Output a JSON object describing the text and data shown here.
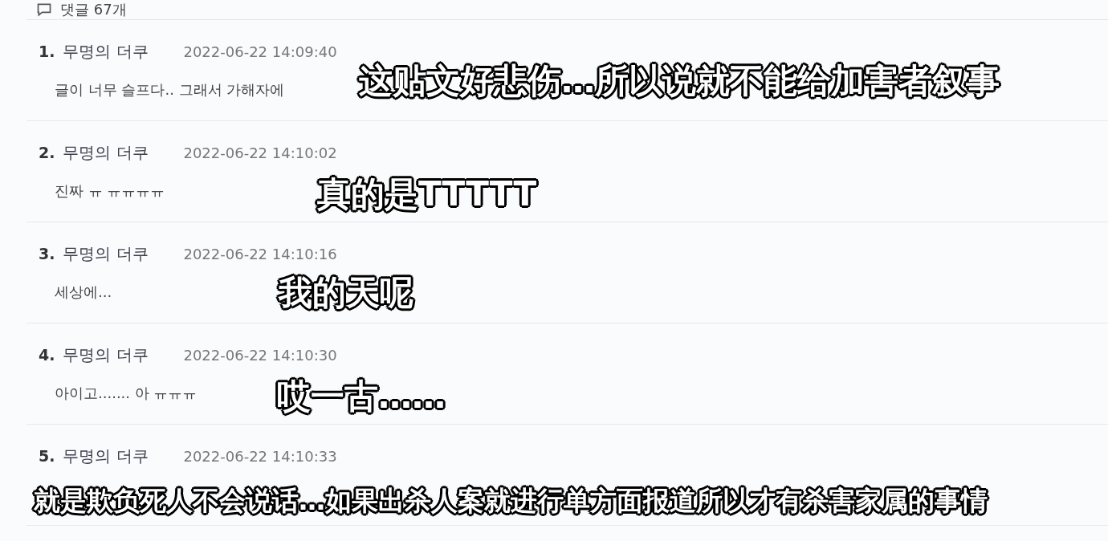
{
  "comments_header": {
    "label": "댓글 67개"
  },
  "comments": [
    {
      "number": "1.",
      "author": "무명의 더쿠",
      "time": "2022-06-22 14:09:40",
      "text": "글이 너무 슬프다.. 그래서 가해자에",
      "caption": "这贴文好悲伤…所以说就不能给加害者叙事"
    },
    {
      "number": "2.",
      "author": "무명의 더쿠",
      "time": "2022-06-22 14:10:02",
      "text": "진짜 ㅠ ㅠㅠㅠㅠ",
      "caption": "真的是TTTTT"
    },
    {
      "number": "3.",
      "author": "무명의 더쿠",
      "time": "2022-06-22 14:10:16",
      "text": "세상에...",
      "caption": "我的天呢"
    },
    {
      "number": "4.",
      "author": "무명의 더쿠",
      "time": "2022-06-22 14:10:30",
      "text": "아이고....... 아 ㅠㅠㅠ",
      "caption": "哎一古……"
    },
    {
      "number": "5.",
      "author": "무명의 더쿠",
      "time": "2022-06-22 14:10:33",
      "caption": "就是欺负死人不会说话…如果出杀人案就进行单方面报道所以才有杀害家属的事情"
    }
  ]
}
